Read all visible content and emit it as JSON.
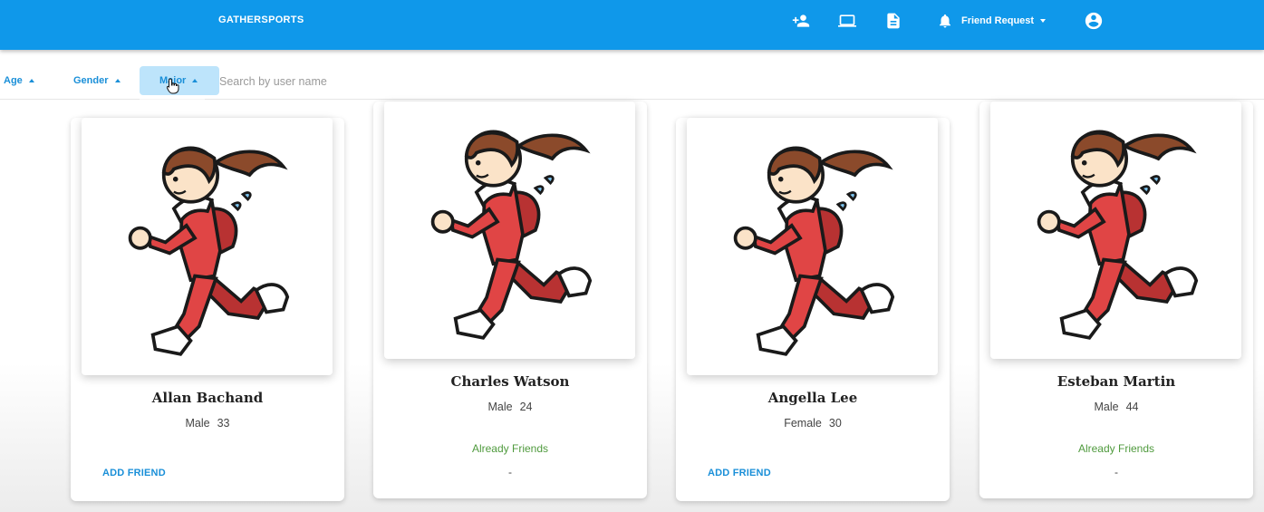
{
  "app": {
    "brand": "GATHERSPORTS"
  },
  "header": {
    "icons": [
      "add-person-icon",
      "laptop-icon",
      "document-icon"
    ],
    "friend_request_label": "Friend Request",
    "colors": {
      "appbar": "#0f98ea"
    }
  },
  "filters": {
    "age_label": "Age",
    "gender_label": "Gender",
    "major_label": "Major",
    "search_placeholder": "Search by user name"
  },
  "users": [
    {
      "name": "Allan Bachand",
      "gender": "Male",
      "age": "33",
      "action": "ADD FRIEND"
    },
    {
      "name": "Charles Watson",
      "gender": "Male",
      "age": "24",
      "status": "Already Friends",
      "extra": "-"
    },
    {
      "name": "Angella Lee",
      "gender": "Female",
      "age": "30",
      "action": "ADD FRIEND"
    },
    {
      "name": "Esteban Martin",
      "gender": "Male",
      "age": "44",
      "status": "Already Friends",
      "extra": "-"
    }
  ]
}
